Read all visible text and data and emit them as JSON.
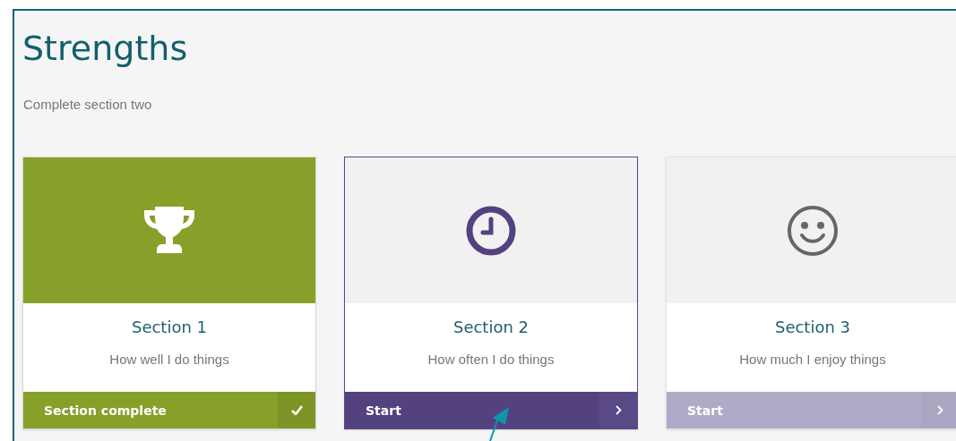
{
  "page": {
    "title": "Strengths",
    "subtitle": "Complete section two"
  },
  "sections": [
    {
      "completed": true,
      "selected": false,
      "disabled": false,
      "title": "Section 1",
      "description": "How well I do things",
      "action": "Section complete"
    },
    {
      "completed": false,
      "selected": true,
      "disabled": false,
      "title": "Section 2",
      "description": "How often I do things",
      "action": "Start"
    },
    {
      "completed": false,
      "selected": false,
      "disabled": true,
      "title": "Section 3",
      "description": "How much I enjoy things",
      "action": "Start"
    }
  ]
}
